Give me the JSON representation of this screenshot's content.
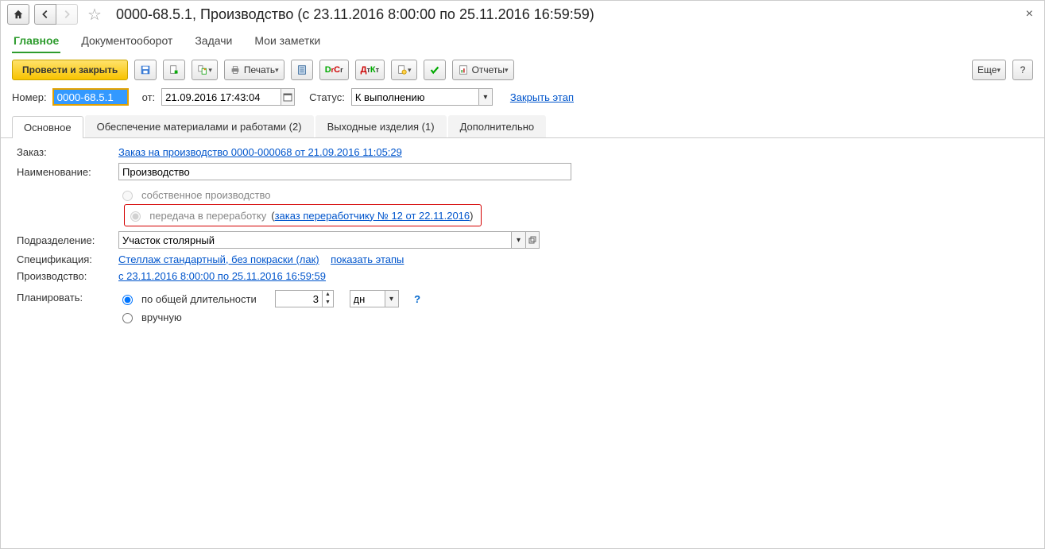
{
  "titlebar": {
    "title": "0000-68.5.1, Производство (с 23.11.2016 8:00:00 по 25.11.2016 16:59:59)"
  },
  "topTabs": {
    "main": "Главное",
    "docflow": "Документооборот",
    "tasks": "Задачи",
    "notes": "Мои заметки"
  },
  "toolbar": {
    "postAndClose": "Провести и закрыть",
    "print": "Печать",
    "reports": "Отчеты",
    "more": "Еще"
  },
  "header": {
    "numberLabel": "Номер:",
    "numberValue": "0000-68.5.1",
    "fromLabel": "от:",
    "fromValue": "21.09.2016 17:43:04",
    "statusLabel": "Статус:",
    "statusValue": "К выполнению",
    "closeStage": "Закрыть этап"
  },
  "subtabs": {
    "main": "Основное",
    "materials": "Обеспечение материалами и работами (2)",
    "output": "Выходные изделия (1)",
    "extra": "Дополнительно"
  },
  "form": {
    "orderLabel": "Заказ:",
    "orderLink": "Заказ на производство 0000-000068 от 21.09.2016 11:05:29",
    "nameLabel": "Наименование:",
    "nameValue": "Производство",
    "ownProd": "собственное производство",
    "outsource": "передача в переработку",
    "outsourceLink": "заказ переработчику № 12 от 22.11.2016",
    "deptLabel": "Подразделение:",
    "deptValue": "Участок столярный",
    "specLabel": "Спецификация:",
    "specLink": "Стеллаж стандартный, без покраски (лак)",
    "showStages": "показать этапы",
    "prodLabel": "Производство:",
    "prodLink": "с 23.11.2016 8:00:00 по 25.11.2016 16:59:59",
    "planLabel": "Планировать:",
    "planByDuration": "по общей длительности",
    "planManual": "вручную",
    "durationValue": "3",
    "durationUnit": "дн"
  }
}
